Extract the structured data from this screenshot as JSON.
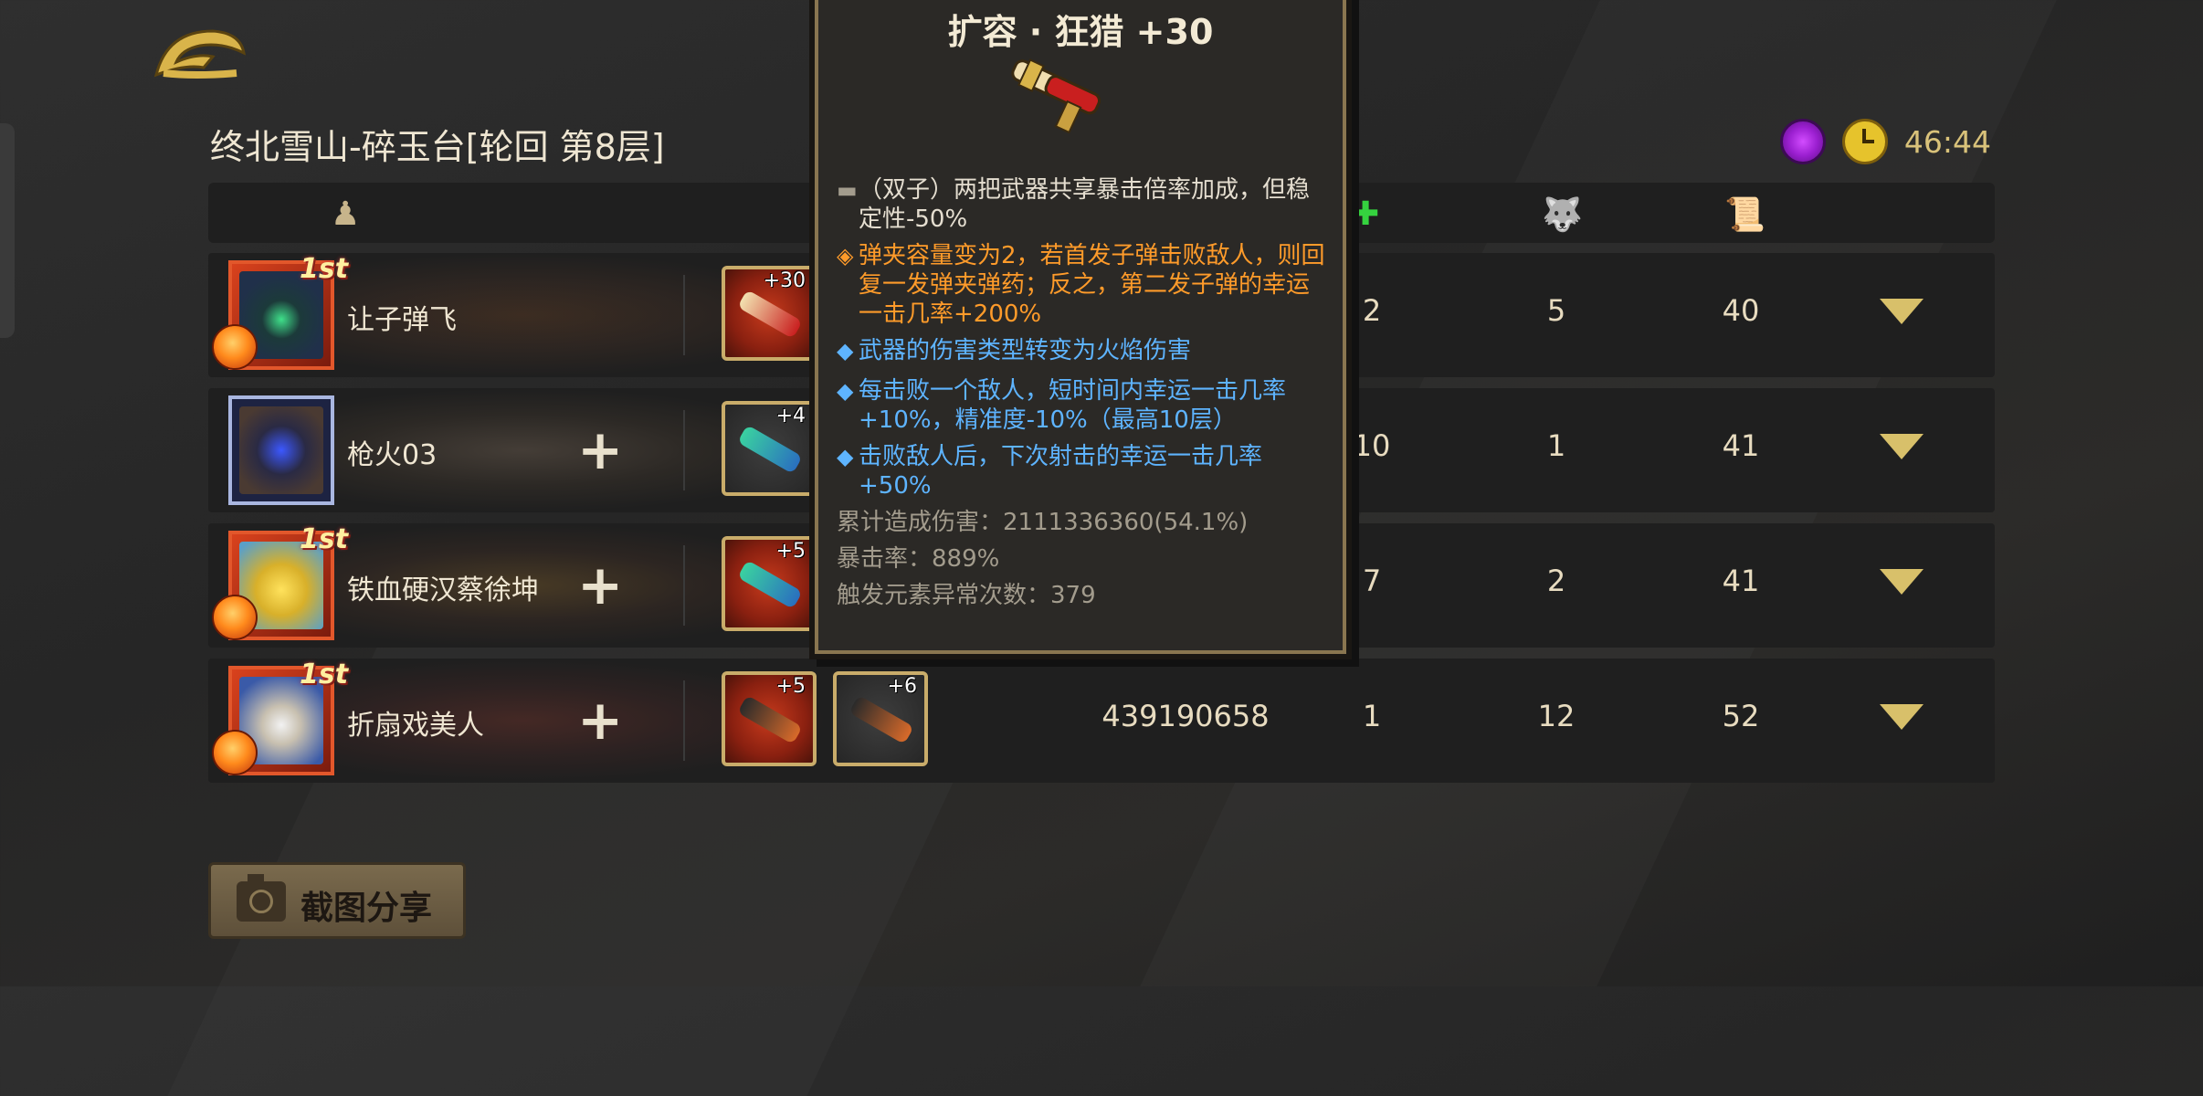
{
  "header": {
    "stage_title": "终北雪山-碎玉台[轮回  第8层]",
    "timer": "46:44"
  },
  "columns": {
    "player_icon": "person-icon",
    "heal_icon": "green-cross-icon",
    "pet_icon": "blue-wolf-icon",
    "scroll_icon": "scroll-icon"
  },
  "rows": [
    {
      "name": "让子弹飞",
      "rank_badge": "1st",
      "weapons": [
        "+30"
      ],
      "damage": "",
      "stat1": "2",
      "stat2": "5",
      "stat3": "40"
    },
    {
      "name": "枪火03",
      "rank_badge": "",
      "weapons": [
        "+4"
      ],
      "damage": "",
      "stat1": "10",
      "stat2": "1",
      "stat3": "41"
    },
    {
      "name": "铁血硬汉蔡徐坤",
      "rank_badge": "1st",
      "weapons": [
        "+5"
      ],
      "damage": "",
      "stat1": "7",
      "stat2": "2",
      "stat3": "41"
    },
    {
      "name": "折扇戏美人",
      "rank_badge": "1st",
      "weapons": [
        "+5",
        "+6"
      ],
      "damage": "439190658",
      "stat1": "1",
      "stat2": "12",
      "stat3": "52"
    }
  ],
  "tooltip": {
    "title": "扩容 · 狂猎 +30",
    "line1": "（双子）两把武器共享暴击倍率加成，但稳定性-50%",
    "line2": "弹夹容量变为2，若首发子弹击败敌人，则回复一发弹夹弹药；反之，第二发子弹的幸运一击几率+200%",
    "line3": "武器的伤害类型转变为火焰伤害",
    "line4": "每击败一个敌人，短时间内幸运一击几率+10%，精准度-10%（最高10层）",
    "line5": "击败敌人后，下次射击的幸运一击几率+50%",
    "stat_damage": "累计造成伤害：2111336360(54.1%)",
    "stat_crit": "暴击率：889%",
    "stat_trigger": "触发元素异常次数：379"
  },
  "share_button": {
    "label": "截图分享"
  },
  "colors": {
    "accent_gold": "#d8c06a",
    "tooltip_orange": "#ff9b2a",
    "tooltip_blue": "#5eb4ff"
  }
}
